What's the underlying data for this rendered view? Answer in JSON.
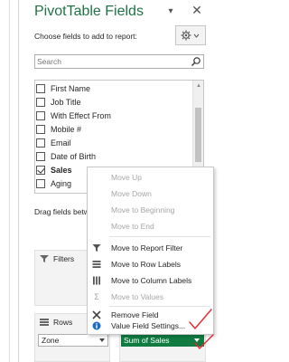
{
  "pane": {
    "title": "PivotTable Fields",
    "choose_label": "Choose fields to add to report:",
    "search_placeholder": "Search",
    "drag_label": "Drag fields between areas below:"
  },
  "fields": [
    {
      "label": "First Name",
      "checked": false,
      "bold": false
    },
    {
      "label": "Job Title",
      "checked": false,
      "bold": false
    },
    {
      "label": "With Effect From",
      "checked": false,
      "bold": false
    },
    {
      "label": "Mobile #",
      "checked": false,
      "bold": false
    },
    {
      "label": "Email",
      "checked": false,
      "bold": false
    },
    {
      "label": "Date of Birth",
      "checked": false,
      "bold": false
    },
    {
      "label": "Sales",
      "checked": true,
      "bold": true
    },
    {
      "label": "Aging",
      "checked": false,
      "bold": false
    }
  ],
  "areas": {
    "filters_label": "Filters",
    "rows_label": "Rows",
    "rows_value": "Zone",
    "values_value": "Sum of Sales"
  },
  "context_menu": {
    "items": [
      {
        "label": "Move Up",
        "enabled": false,
        "icon": ""
      },
      {
        "label": "Move Down",
        "enabled": false,
        "icon": ""
      },
      {
        "label": "Move to Beginning",
        "enabled": false,
        "icon": ""
      },
      {
        "label": "Move to End",
        "enabled": false,
        "icon": ""
      },
      {
        "label": "Move to Report Filter",
        "enabled": true,
        "icon": "filter-icon"
      },
      {
        "label": "Move to Row Labels",
        "enabled": true,
        "icon": "rows-icon"
      },
      {
        "label": "Move to Column Labels",
        "enabled": true,
        "icon": "columns-icon"
      },
      {
        "label": "Move to Values",
        "enabled": false,
        "icon": "sigma-icon"
      },
      {
        "label": "Remove Field",
        "enabled": true,
        "icon": "remove-icon"
      },
      {
        "label": "Value Field Settings...",
        "enabled": true,
        "icon": "info-icon"
      }
    ]
  },
  "colors": {
    "title": "#217346",
    "value_pill": "#107c41",
    "annotation": "#e8262c"
  }
}
